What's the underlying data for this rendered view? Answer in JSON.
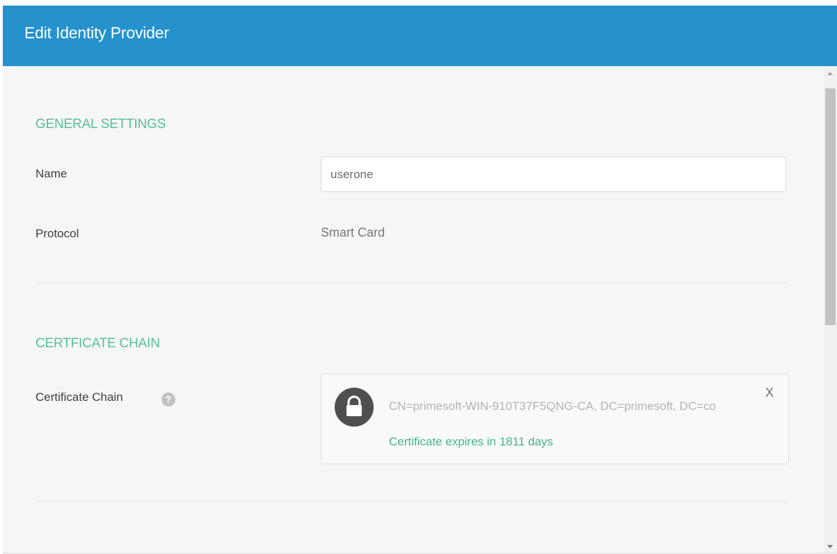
{
  "dialog": {
    "title": "Edit Identity Provider"
  },
  "general": {
    "section_title": "GENERAL SETTINGS",
    "name_label": "Name",
    "name_value": "userone",
    "protocol_label": "Protocol",
    "protocol_value": "Smart Card"
  },
  "certificate": {
    "section_title": "CERTFICATE CHAIN",
    "chain_label": "Certificate Chain",
    "help_icon": "?",
    "subject": "CN=primesoft-WIN-910T37F5QNG-CA, DC=primesoft, DC=co",
    "expiry": "Certificate expires in 1811 days",
    "remove_label": "X",
    "icon": "lock-icon"
  },
  "colors": {
    "header_bg": "#2592ce",
    "section_title": "#57bf9c",
    "expiry_text": "#45b38f"
  }
}
